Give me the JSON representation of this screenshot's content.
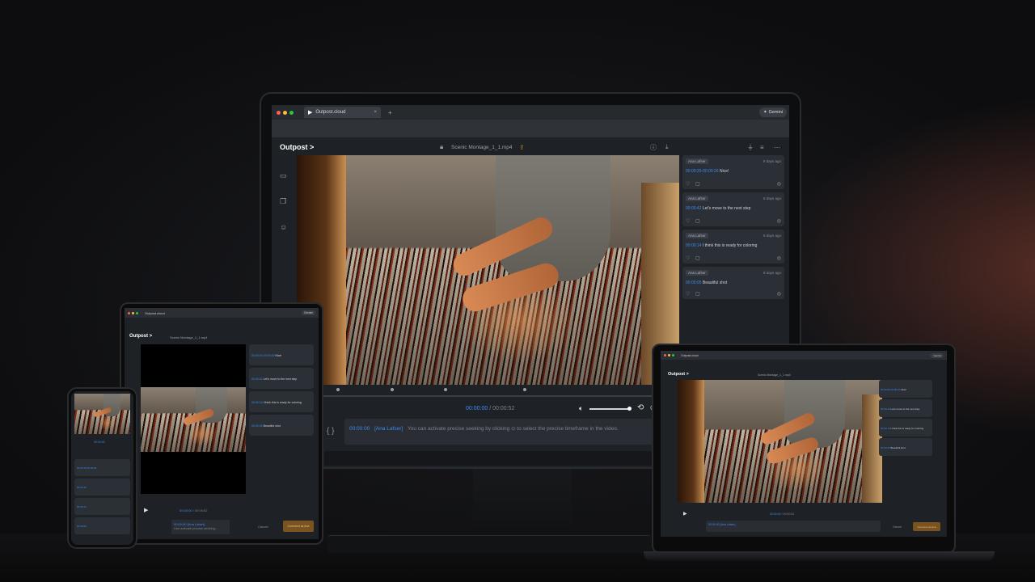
{
  "app": {
    "brand": "Outpost",
    "tab_title": "Outpost.cloud",
    "gemini_label": "Gemini"
  },
  "file": {
    "name": "Scenic Montage_1_1.mp4",
    "name_short": "Scenic Montage_1_1.mp4"
  },
  "player": {
    "current": "00:00:00",
    "separator": " / ",
    "duration": "00:00:52"
  },
  "comments": [
    {
      "author": "Ana Lafser",
      "ago": "8 days ago",
      "time": "00:00:20-00:00:26",
      "text": "Nice!"
    },
    {
      "author": "Ana Lafser",
      "ago": "8 days ago",
      "time": "00:00:42",
      "text": "Let's move to the next step"
    },
    {
      "author": "Ana Lafser",
      "ago": "8 days ago",
      "time": "00:00:14",
      "text": "I think this is ready for coloring"
    },
    {
      "author": "Ana Lafser",
      "ago": "8 days ago",
      "time": "00:00:05",
      "text": "Beautiful shot"
    }
  ],
  "composer": {
    "time": "00:00:00",
    "author": "[Ana Lafser]",
    "placeholder": "You can activate precise seeking by clicking ⊙ to select the precise timeframe in the video.",
    "braces": "{ }"
  },
  "tablet": {
    "cancel": "Cancel",
    "submit": "Comment as Ana",
    "composer_author": "[Ana Lafser]",
    "composer_hint": "Use activate precise seeking..."
  },
  "colors": {
    "accent": "#3d8bf2",
    "brand_orange": "#c58a2e",
    "bg": "#1e2126"
  },
  "icons": [
    "folder-icon",
    "files-icon",
    "users-icon",
    "lock-icon",
    "share-icon",
    "info-icon",
    "download-icon",
    "filter-icon",
    "sort-icon",
    "more-icon",
    "heart-icon",
    "reply-icon",
    "check-circle-icon",
    "edit-icon",
    "volume-icon",
    "loop-icon",
    "fullscreen-icon",
    "play-icon"
  ]
}
